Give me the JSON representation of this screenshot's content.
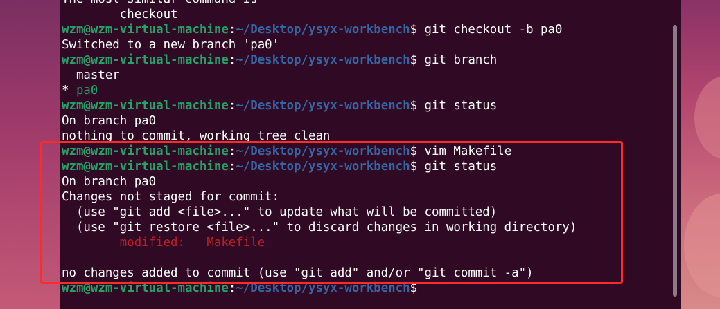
{
  "terminal": {
    "lines": [
      {
        "kind": "text",
        "text": "The most similar command is",
        "color": "plain"
      },
      {
        "kind": "text",
        "text": "        checkout",
        "color": "plain"
      },
      {
        "kind": "prompt",
        "user": "wzm@wzm-virtual-machine",
        "sep": ":",
        "path": "~/Desktop/ysyx-workbench",
        "symbol": "$ ",
        "cmd": "git checkout -b pa0"
      },
      {
        "kind": "text",
        "text": "Switched to a new branch 'pa0'",
        "color": "plain"
      },
      {
        "kind": "prompt",
        "user": "wzm@wzm-virtual-machine",
        "sep": ":",
        "path": "~/Desktop/ysyx-workbench",
        "symbol": "$ ",
        "cmd": "git branch"
      },
      {
        "kind": "text",
        "text": "  master",
        "color": "plain"
      },
      {
        "kind": "branch",
        "marker": "* ",
        "text": "pa0",
        "color": "green"
      },
      {
        "kind": "prompt",
        "user": "wzm@wzm-virtual-machine",
        "sep": ":",
        "path": "~/Desktop/ysyx-workbench",
        "symbol": "$ ",
        "cmd": "git status"
      },
      {
        "kind": "text",
        "text": "On branch pa0",
        "color": "plain"
      },
      {
        "kind": "text",
        "text": "nothing to commit, working tree clean",
        "color": "plain"
      },
      {
        "kind": "prompt",
        "user": "wzm@wzm-virtual-machine",
        "sep": ":",
        "path": "~/Desktop/ysyx-workbench",
        "symbol": "$ ",
        "cmd": "vim Makefile"
      },
      {
        "kind": "prompt",
        "user": "wzm@wzm-virtual-machine",
        "sep": ":",
        "path": "~/Desktop/ysyx-workbench",
        "symbol": "$ ",
        "cmd": "git status"
      },
      {
        "kind": "text",
        "text": "On branch pa0",
        "color": "plain"
      },
      {
        "kind": "text",
        "text": "Changes not staged for commit:",
        "color": "plain"
      },
      {
        "kind": "text",
        "text": "  (use \"git add <file>...\" to update what will be committed)",
        "color": "plain"
      },
      {
        "kind": "text",
        "text": "  (use \"git restore <file>...\" to discard changes in working directory)",
        "color": "plain"
      },
      {
        "kind": "text",
        "text": "        modified:   Makefile",
        "color": "red"
      },
      {
        "kind": "text",
        "text": "",
        "color": "plain"
      },
      {
        "kind": "text",
        "text": "no changes added to commit (use \"git add\" and/or \"git commit -a\")",
        "color": "plain"
      },
      {
        "kind": "prompt",
        "user": "wzm@wzm-virtual-machine",
        "sep": ":",
        "path": "~/Desktop/ysyx-workbench",
        "symbol": "$ ",
        "cmd": ""
      }
    ]
  },
  "colors": {
    "terminal_bg": "#300a24",
    "prompt_user": "#26a269",
    "prompt_path": "#3465a4",
    "modified": "#c01c28",
    "highlight_box": "#ff2a2a"
  }
}
